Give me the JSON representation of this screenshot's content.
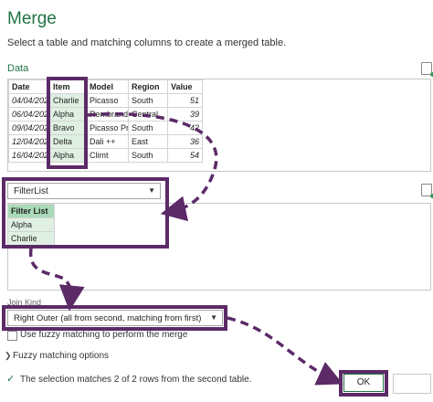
{
  "dialog": {
    "title": "Merge",
    "subtitle": "Select a table and matching columns to create a merged table."
  },
  "data_section": {
    "label": "Data",
    "columns": [
      "Date",
      "Item",
      "Model",
      "Region",
      "Value"
    ],
    "rows": [
      [
        "04/04/202",
        "Charlie",
        "Picasso",
        "South",
        "51"
      ],
      [
        "06/04/202",
        "Alpha",
        "Rembrandt",
        "Central",
        "39"
      ],
      [
        "09/04/202",
        "Bravo",
        "Picasso Pro",
        "South",
        "42"
      ],
      [
        "12/04/202",
        "Delta",
        "Dali ++",
        "East",
        "36"
      ],
      [
        "16/04/202",
        "Alpha",
        "Climt",
        "South",
        "54"
      ]
    ]
  },
  "second_table": {
    "selected": "FilterList",
    "header": "Filter List",
    "rows": [
      "Alpha",
      "Charlie"
    ]
  },
  "join_kind": {
    "label": "Join Kind",
    "selected": "Right Outer (all from second, matching from first)"
  },
  "fuzzy": {
    "checkbox_label": "Use fuzzy matching to perform the merge",
    "options_label": "Fuzzy matching options"
  },
  "status": {
    "message": "The selection matches 2 of 2 rows from the second table."
  },
  "buttons": {
    "ok": "OK"
  },
  "colors": {
    "accent": "#217346",
    "highlight": "#5b2a67",
    "selection": "#dff0e3"
  }
}
